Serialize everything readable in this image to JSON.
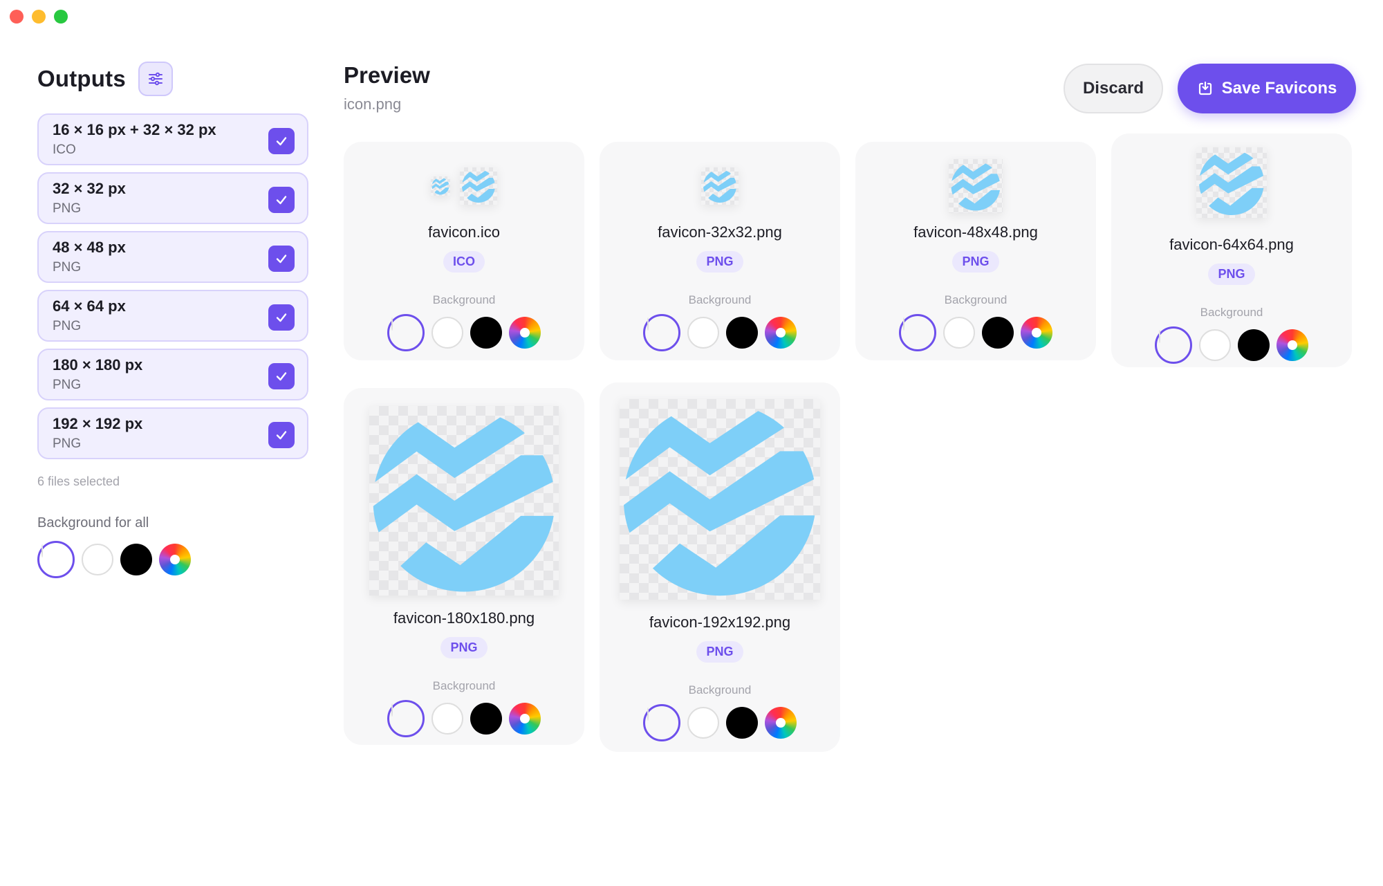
{
  "window": {
    "controls": [
      "close",
      "minimize",
      "zoom"
    ]
  },
  "sidebar": {
    "title": "Outputs",
    "filter_icon": "sliders-icon",
    "outputs": [
      {
        "size": "16 × 16 px + 32 × 32 px",
        "format": "ICO",
        "checked": true
      },
      {
        "size": "32 × 32 px",
        "format": "PNG",
        "checked": true
      },
      {
        "size": "48 × 48 px",
        "format": "PNG",
        "checked": true
      },
      {
        "size": "64 × 64 px",
        "format": "PNG",
        "checked": true
      },
      {
        "size": "180 × 180 px",
        "format": "PNG",
        "checked": true
      },
      {
        "size": "192 × 192 px",
        "format": "PNG",
        "checked": true
      }
    ],
    "files_selected": "6 files selected",
    "background_label": "Background for all",
    "background_selected": "transparent"
  },
  "header": {
    "title": "Preview",
    "filename": "icon.png",
    "discard_label": "Discard",
    "save_label": "Save Favicons",
    "save_icon": "save-download-icon"
  },
  "previews": [
    {
      "name": "favicon.ico",
      "format": "ICO",
      "background_label": "Background",
      "background_selected": "transparent"
    },
    {
      "name": "favicon-32x32.png",
      "format": "PNG",
      "background_label": "Background",
      "background_selected": "transparent"
    },
    {
      "name": "favicon-48x48.png",
      "format": "PNG",
      "background_label": "Background",
      "background_selected": "transparent"
    },
    {
      "name": "favicon-64x64.png",
      "format": "PNG",
      "background_label": "Background",
      "background_selected": "transparent"
    },
    {
      "name": "favicon-180x180.png",
      "format": "PNG",
      "background_label": "Background",
      "background_selected": "transparent"
    },
    {
      "name": "favicon-192x192.png",
      "format": "PNG",
      "background_label": "Background",
      "background_selected": "transparent"
    }
  ],
  "background_options": [
    "transparent",
    "white",
    "black",
    "custom-color"
  ],
  "colors": {
    "accent": "#6d4fec",
    "icon_blue": "#7ecff8",
    "badge_bg": "#ebe8fd"
  }
}
